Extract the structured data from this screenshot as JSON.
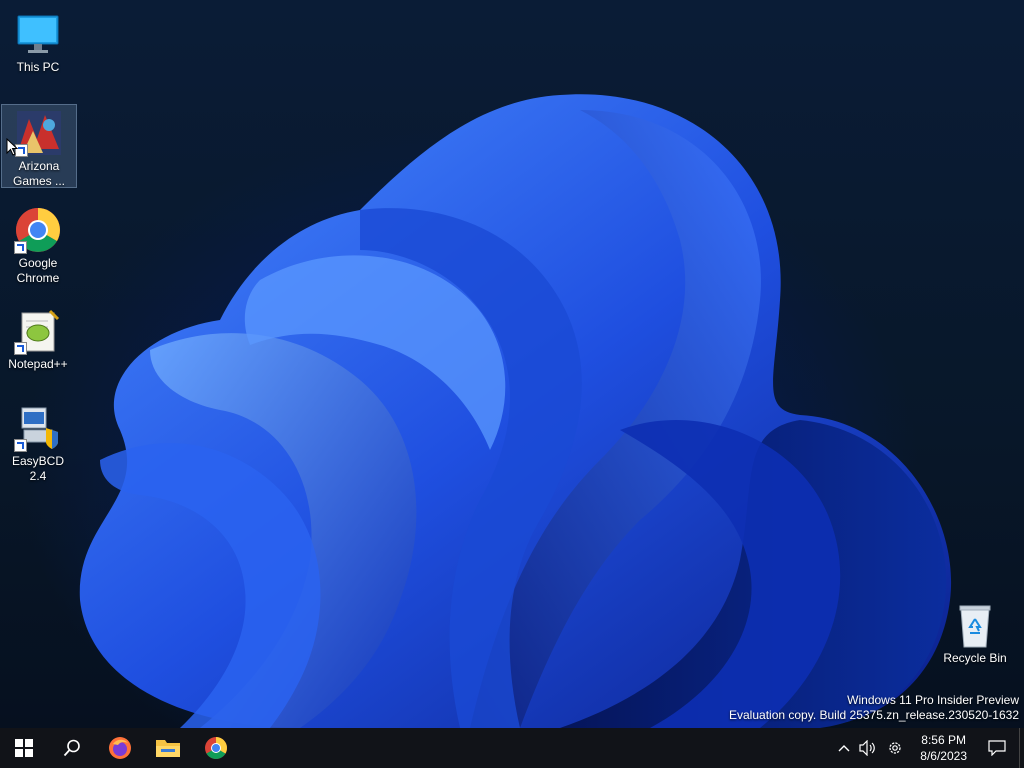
{
  "desktop": {
    "icons": [
      {
        "label": "This PC",
        "icon": "computer-icon"
      },
      {
        "label": "Arizona Games ...",
        "icon": "arizona-games-icon"
      },
      {
        "label": "Google Chrome",
        "icon": "chrome-icon"
      },
      {
        "label": "Notepad++",
        "icon": "notepad-plus-plus-icon"
      },
      {
        "label": "EasyBCD 2.4",
        "icon": "easybcd-icon"
      },
      {
        "label": "Recycle Bin",
        "icon": "recycle-bin-icon"
      }
    ]
  },
  "watermark": {
    "line1": "Windows 11 Pro Insider Preview",
    "line2": "Evaluation copy. Build 25375.zn_release.230520-1632"
  },
  "taskbar": {
    "pinned": [
      "start-icon",
      "search-icon",
      "firefox-icon",
      "file-explorer-icon",
      "chrome-icon"
    ],
    "clock": {
      "time": "8:56 PM",
      "date": "8/6/2023"
    },
    "colors": {
      "background": "#111318",
      "accent": "#76b9ed"
    }
  }
}
